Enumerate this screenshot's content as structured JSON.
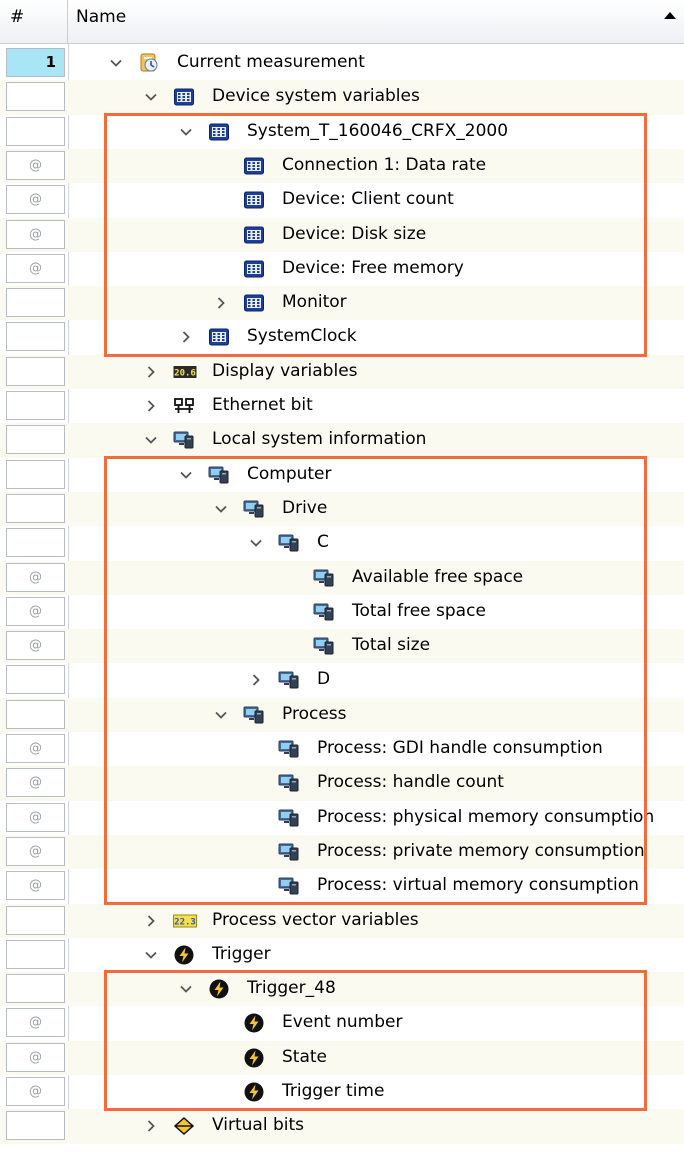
{
  "header": {
    "num_label": "#",
    "name_label": "Name"
  },
  "selected_row_number": "1",
  "null_marker": "@",
  "colors": {
    "highlight_box": "#f26b3a",
    "row_alt": "#fbfaf1",
    "selected": "#a8e6f6"
  },
  "rows": [
    {
      "label": "Current measurement",
      "depth": 0,
      "toggle": "expanded",
      "icon": "measurement-icon",
      "num": "1"
    },
    {
      "label": "Device system variables",
      "depth": 1,
      "toggle": "expanded",
      "icon": "system-variables-icon",
      "num": ""
    },
    {
      "label": "System_T_160046_CRFX_2000",
      "depth": 2,
      "toggle": "expanded",
      "icon": "system-variables-icon",
      "num": ""
    },
    {
      "label": "Connection 1: Data rate",
      "depth": 3,
      "toggle": "none",
      "icon": "system-variables-icon",
      "num": "@"
    },
    {
      "label": "Device: Client count",
      "depth": 3,
      "toggle": "none",
      "icon": "system-variables-icon",
      "num": "@"
    },
    {
      "label": "Device: Disk size",
      "depth": 3,
      "toggle": "none",
      "icon": "system-variables-icon",
      "num": "@"
    },
    {
      "label": "Device: Free memory",
      "depth": 3,
      "toggle": "none",
      "icon": "system-variables-icon",
      "num": "@"
    },
    {
      "label": "Monitor",
      "depth": 3,
      "toggle": "collapsed",
      "icon": "system-variables-icon",
      "num": ""
    },
    {
      "label": "SystemClock",
      "depth": 2,
      "toggle": "collapsed",
      "icon": "system-variables-icon",
      "num": ""
    },
    {
      "label": "Display variables",
      "depth": 1,
      "toggle": "collapsed",
      "icon": "display-variable-icon",
      "num": ""
    },
    {
      "label": "Ethernet bit",
      "depth": 1,
      "toggle": "collapsed",
      "icon": "ethernet-icon",
      "num": ""
    },
    {
      "label": "Local system information",
      "depth": 1,
      "toggle": "expanded",
      "icon": "computer-icon",
      "num": ""
    },
    {
      "label": "Computer",
      "depth": 2,
      "toggle": "expanded",
      "icon": "computer-icon",
      "num": ""
    },
    {
      "label": "Drive",
      "depth": 3,
      "toggle": "expanded",
      "icon": "computer-icon",
      "num": ""
    },
    {
      "label": "C",
      "depth": 4,
      "toggle": "expanded",
      "icon": "computer-icon",
      "num": ""
    },
    {
      "label": "Available free space",
      "depth": 5,
      "toggle": "none",
      "icon": "computer-icon",
      "num": "@"
    },
    {
      "label": "Total free space",
      "depth": 5,
      "toggle": "none",
      "icon": "computer-icon",
      "num": "@"
    },
    {
      "label": "Total size",
      "depth": 5,
      "toggle": "none",
      "icon": "computer-icon",
      "num": "@"
    },
    {
      "label": "D",
      "depth": 4,
      "toggle": "collapsed",
      "icon": "computer-icon",
      "num": ""
    },
    {
      "label": "Process",
      "depth": 3,
      "toggle": "expanded",
      "icon": "computer-icon",
      "num": ""
    },
    {
      "label": "Process: GDI handle consumption",
      "depth": 4,
      "toggle": "none",
      "icon": "computer-icon",
      "num": "@"
    },
    {
      "label": "Process: handle count",
      "depth": 4,
      "toggle": "none",
      "icon": "computer-icon",
      "num": "@"
    },
    {
      "label": "Process: physical memory consumption",
      "depth": 4,
      "toggle": "none",
      "icon": "computer-icon",
      "num": "@"
    },
    {
      "label": "Process: private memory consumption",
      "depth": 4,
      "toggle": "none",
      "icon": "computer-icon",
      "num": "@"
    },
    {
      "label": "Process: virtual memory consumption",
      "depth": 4,
      "toggle": "none",
      "icon": "computer-icon",
      "num": "@"
    },
    {
      "label": "Process vector variables",
      "depth": 1,
      "toggle": "collapsed",
      "icon": "vector-variable-icon",
      "num": ""
    },
    {
      "label": "Trigger",
      "depth": 1,
      "toggle": "expanded",
      "icon": "trigger-icon",
      "num": ""
    },
    {
      "label": "Trigger_48",
      "depth": 2,
      "toggle": "expanded",
      "icon": "trigger-icon",
      "num": ""
    },
    {
      "label": "Event number",
      "depth": 3,
      "toggle": "none",
      "icon": "trigger-icon",
      "num": "@"
    },
    {
      "label": "State",
      "depth": 3,
      "toggle": "none",
      "icon": "trigger-icon",
      "num": "@"
    },
    {
      "label": "Trigger time",
      "depth": 3,
      "toggle": "none",
      "icon": "trigger-icon",
      "num": "@"
    },
    {
      "label": "Virtual bits",
      "depth": 1,
      "toggle": "collapsed",
      "icon": "virtual-bits-icon",
      "num": ""
    }
  ],
  "highlight_groups": [
    {
      "from_row": 2,
      "to_row": 8
    },
    {
      "from_row": 12,
      "to_row": 24
    },
    {
      "from_row": 27,
      "to_row": 30
    }
  ]
}
